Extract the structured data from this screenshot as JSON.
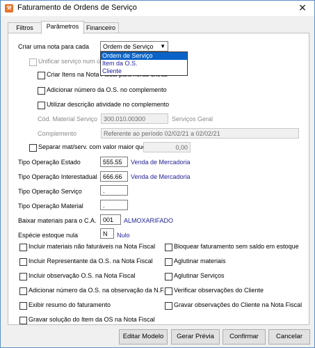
{
  "window": {
    "title": "Faturamento de Ordens de Serviço",
    "close_label": "✕"
  },
  "tabs": [
    {
      "label": "Filtros"
    },
    {
      "label": "Parâmetros"
    },
    {
      "label": "Financeiro"
    }
  ],
  "criar_nota": {
    "label": "Criar uma nota para cada",
    "selected": "Ordem de Serviço",
    "options": [
      "Ordem de Serviço",
      "Item da O.S.",
      "Cliente"
    ]
  },
  "top_checks": {
    "unificar": "Unificar serviço num único",
    "criar_itens": "Criar Itens na Nota Fiscal para horas extras",
    "adicionar_os": "Adicionar número da O.S. no complemento",
    "utilizar_desc": "Utilizar descrição atividade no complemento"
  },
  "material": {
    "cod_label": "Cód. Material Serviço",
    "cod_value": "300.010.00300",
    "cod_desc": "Serviços Geral",
    "comp_label": "Complemento",
    "comp_value": "Referente ao período 02/02/21 a 02/02/21",
    "separar_label": "Separar mat/serv. com valor maior que",
    "separar_value": "0,00"
  },
  "operacoes": {
    "estado_label": "Tipo Operação Estado",
    "estado_value": "555.55",
    "estado_desc": "Venda de Mercadoria",
    "inter_label": "Tipo Operação Interestadual",
    "inter_value": "666.66",
    "inter_desc": "Venda de Mercadoria",
    "servico_label": "Tipo Operação Serviço",
    "servico_value": ".",
    "material_label": "Tipo Operação Material",
    "material_value": ".",
    "baixar_label": "Baixar materiais para o C.A.",
    "baixar_value": "001",
    "baixar_desc": "ALMOXARIFADO",
    "especie_label": "Espécie estoque nula",
    "especie_value": "N",
    "especie_desc": "Nulo"
  },
  "options_left": [
    "Incluir materiais não faturáveis na Nota Fiscal",
    "Incluir Representante da O.S. na Nota Fiscal",
    "Incluir observação O.S. na Nota Fiscal",
    "Adicionar número da O.S. na observação da N.F.",
    "Exibir resumo do faturamento",
    "Gravar solução do Item da OS na Nota Fiscal"
  ],
  "options_right": [
    "Bloquear faturamento sem saldo em estoque",
    "Aglutinar materiais",
    "Aglutinar Serviços",
    "Verificar observações do Cliente",
    "Gravar observações do Cliente na Nota Fiscal"
  ],
  "buttons": {
    "editar": "Editar Modelo",
    "gerar": "Gerar Prévia",
    "confirmar": "Confirmar",
    "cancelar": "Cancelar"
  }
}
